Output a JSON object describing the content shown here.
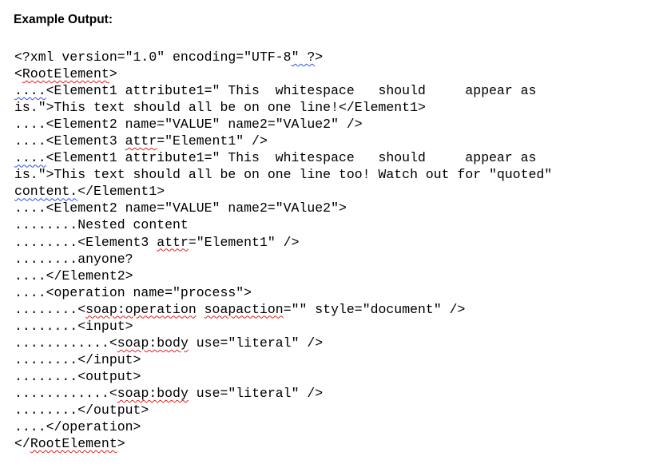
{
  "heading": "Example Output:",
  "colors": {
    "spelling_underline": "#e0201a",
    "grammar_underline": "#2a52e8"
  },
  "lines": [
    [
      [
        "<?xml version=\"1.0\" encoding=\"UTF-8",
        ""
      ],
      [
        "\" ?",
        "grammar"
      ],
      [
        ">",
        ""
      ]
    ],
    [
      [
        "<",
        ""
      ],
      [
        "RootElement",
        "spelling"
      ],
      [
        ">",
        ""
      ]
    ],
    [
      [
        "....",
        "grammar"
      ],
      [
        "<Element1 attribute1=\" This  whitespace   should     appear as",
        ""
      ]
    ],
    [
      [
        "is.\">This text should all be on one line!</Element1>",
        ""
      ]
    ],
    [
      [
        "....<Element2 name=\"VALUE\" name2=\"VAlue2\" />",
        ""
      ]
    ],
    [
      [
        "....<Element3 ",
        ""
      ],
      [
        "attr",
        "spelling"
      ],
      [
        "=\"Element1\" />",
        ""
      ]
    ],
    [
      [
        "....",
        "grammar"
      ],
      [
        "<Element1 attribute1=\" This  whitespace   should     appear as",
        ""
      ]
    ],
    [
      [
        "is.\">This text should all be on one line too! Watch out for \"quoted\"",
        ""
      ]
    ],
    [
      [
        "content.",
        "grammar"
      ],
      [
        "</Element1>",
        ""
      ]
    ],
    [
      [
        "....<Element2 name=\"VALUE\" name2=\"VAlue2\">",
        ""
      ]
    ],
    [
      [
        "........Nested content",
        ""
      ]
    ],
    [
      [
        "........<Element3 ",
        ""
      ],
      [
        "attr",
        "spelling"
      ],
      [
        "=\"Element1\" />",
        ""
      ]
    ],
    [
      [
        "........anyone?",
        ""
      ]
    ],
    [
      [
        "....</Element2>",
        ""
      ]
    ],
    [
      [
        "....<operation name=\"process\">",
        ""
      ]
    ],
    [
      [
        "........<",
        ""
      ],
      [
        "soap:operation",
        "spelling"
      ],
      [
        " ",
        ""
      ],
      [
        "soapaction",
        "spelling"
      ],
      [
        "=\"\" style=\"document\" />",
        ""
      ]
    ],
    [
      [
        "........<input>",
        ""
      ]
    ],
    [
      [
        "............<",
        ""
      ],
      [
        "soap:body",
        "spelling"
      ],
      [
        " use=\"literal\" />",
        ""
      ]
    ],
    [
      [
        "........</input>",
        ""
      ]
    ],
    [
      [
        "........<output>",
        ""
      ]
    ],
    [
      [
        "............<",
        ""
      ],
      [
        "soap:body",
        "spelling"
      ],
      [
        " use=\"literal\" />",
        ""
      ]
    ],
    [
      [
        "........</output>",
        ""
      ]
    ],
    [
      [
        "....</operation>",
        ""
      ]
    ],
    [
      [
        "</",
        ""
      ],
      [
        "RootElement",
        "spelling"
      ],
      [
        ">",
        ""
      ]
    ]
  ]
}
